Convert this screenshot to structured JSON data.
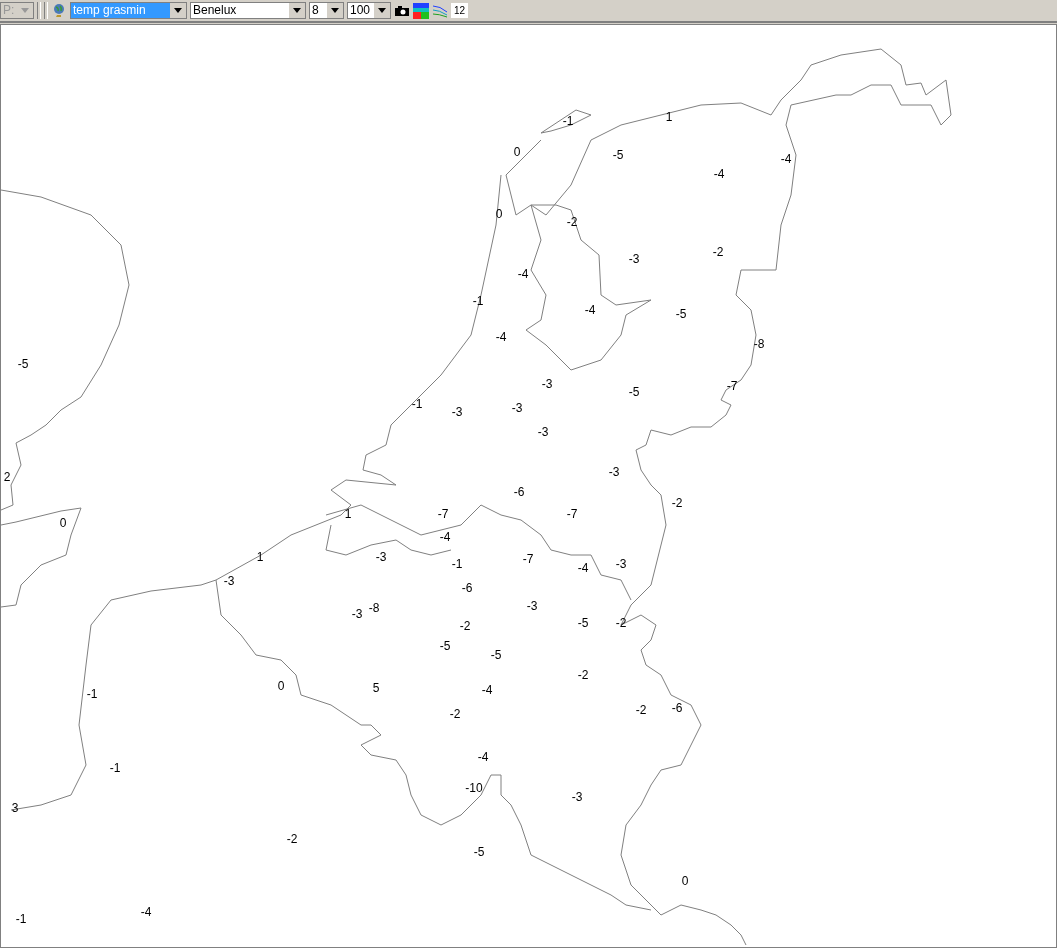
{
  "toolbar": {
    "combos": [
      {
        "value": "P:",
        "disabled": true,
        "selected": false
      },
      {
        "value": "temp grasmin",
        "disabled": false,
        "selected": true
      },
      {
        "value": "Benelux",
        "disabled": false,
        "selected": false
      },
      {
        "value": "8",
        "disabled": false,
        "selected": false
      },
      {
        "value": "100",
        "disabled": false,
        "selected": false
      }
    ],
    "counter": "12"
  },
  "map": {
    "labels": [
      "-1",
      "1",
      "0",
      "-5",
      "-4",
      "-4",
      "0",
      "-2",
      "-2",
      "-3",
      "-4",
      "-1",
      "-4",
      "-5",
      "-4",
      "-8",
      "-5",
      "-3",
      "-5",
      "-7",
      "-1",
      "-3",
      "-3",
      "-3",
      "-3",
      "2",
      "-6",
      "-2",
      "1",
      "-7",
      "-7",
      "0",
      "-4",
      "1",
      "-3",
      "-1",
      "-7",
      "-4",
      "-3",
      "-3",
      "-6",
      "-3",
      "-3",
      "-8",
      "-2",
      "-5",
      "-2",
      "-5",
      "-5",
      "-2",
      "0",
      "5",
      "-4",
      "-1",
      "-2",
      "-6",
      "-2",
      "-4",
      "-1",
      "-10",
      "-3",
      "3",
      "-2",
      "-5",
      "0",
      "-4",
      "-1"
    ]
  }
}
